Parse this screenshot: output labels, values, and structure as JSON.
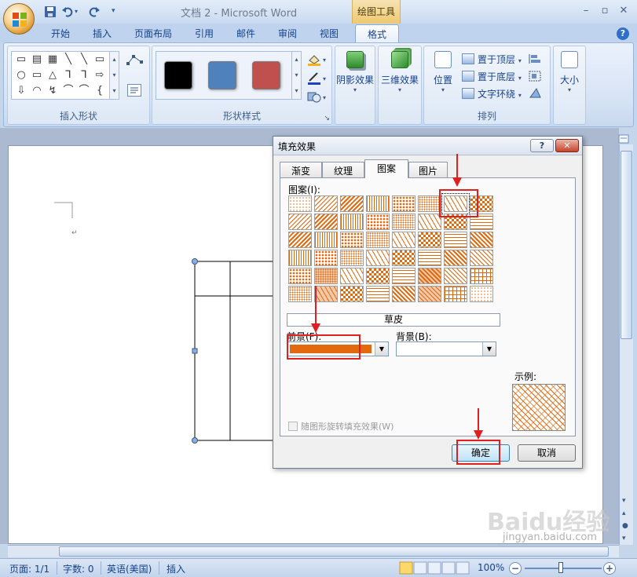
{
  "app": {
    "title": "文档 2 - Microsoft Word",
    "context_tab_group": "绘图工具",
    "window_controls": {
      "minimize": "–",
      "maximize": "▫",
      "close": "✕"
    },
    "help": "?"
  },
  "ribbon": {
    "tabs": [
      "开始",
      "插入",
      "页面布局",
      "引用",
      "邮件",
      "审阅",
      "视图"
    ],
    "active_tab": "格式",
    "groups": {
      "insert_shapes": "插入形状",
      "shape_styles": "形状样式",
      "arrange": "排列"
    },
    "shape_glyphs": [
      "▭",
      "▤",
      "▦",
      "╲",
      "╲",
      "▭",
      "○",
      "▭",
      "△",
      "⅂",
      "⅂",
      "⇨",
      "⇩",
      "◠",
      "↯",
      "⌒",
      "⌒",
      "{"
    ],
    "swatch_colors": [
      "#000000",
      "#4f81bd",
      "#c0504d"
    ],
    "shadow_effect": "阴影效果",
    "3d_effect": "三维效果",
    "position": "位置",
    "bring_to_front": "置于顶层",
    "send_to_back": "置于底层",
    "text_wrapping": "文字环绕",
    "size": "大小"
  },
  "dialog": {
    "title": "填充效果",
    "help": "?",
    "close": "✕",
    "tabs": [
      "渐变",
      "纹理",
      "图案",
      "图片"
    ],
    "active_tab": "图案",
    "pattern_label": "图案(I):",
    "selected_pattern_name": "草皮",
    "foreground_label": "前景(F):",
    "background_label": "背景(B):",
    "foreground_color": "#e2690d",
    "background_color": "#ffffff",
    "sample_label": "示例:",
    "rotate_label": "随图形旋转填充效果(W)",
    "ok": "确定",
    "cancel": "取消"
  },
  "status": {
    "page": "页面: 1/1",
    "words": "字数: 0",
    "language": "英语(美国)",
    "mode": "插入",
    "zoom": "100%"
  },
  "watermark": {
    "logo": "Baidu经验",
    "url": "jingyan.baidu.com"
  },
  "accent_colors": {
    "pattern": "#e2690d",
    "annotation": "#e02020"
  }
}
